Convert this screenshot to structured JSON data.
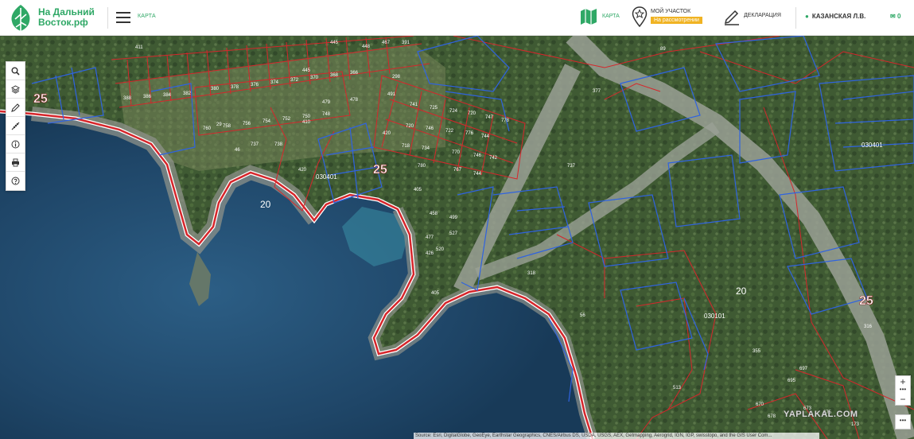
{
  "header": {
    "logo_line1": "На Дальний",
    "logo_line2": "Восток.рф",
    "menu_label": "КАРТА",
    "nav_map": "КАРТА",
    "nav_my_plot": "МОЙ УЧАСТОК",
    "nav_my_plot_status": "На рассмотрении",
    "nav_declaration": "ДЕКЛАРАЦИЯ",
    "user_name": "КАЗАНСКАЯ Л.В.",
    "messages_count": "0"
  },
  "colors": {
    "brand": "#2fa866",
    "status_badge": "#f0b323",
    "parcel_red": "#d6262b",
    "parcel_blue": "#2f63e0"
  },
  "toolbar": {
    "icons": [
      "search-icon",
      "layers-icon",
      "pencil-icon",
      "ruler-icon",
      "info-icon",
      "print-icon",
      "help-icon"
    ]
  },
  "map": {
    "labels": {
      "zone_left": "25",
      "zone_center": "25",
      "zone_right": "25",
      "lot_20_a": "20",
      "lot_20_b": "20",
      "code_right": "030401",
      "code_center": "030101",
      "code_west": "030401",
      "lot_89": "89",
      "lot_318": "318",
      "lot_316": "316",
      "lot_355": "355",
      "lot_513": "513",
      "lot_737": "737",
      "lot_405": "405",
      "lot_56": "56",
      "lot_420": "420",
      "lot_411": "411",
      "lot_391": "391",
      "lot_377": "377",
      "lot_29": "29"
    },
    "zoom_in": "+",
    "zoom_out": "−",
    "more": "•••",
    "watermark": "YAPLAKAL.COM",
    "attribution": "Source: Esri, DigitalGlobe, GeoEye, Earthstar Geographics, CNES/Airbus DS, USDA, USGS, AEX, Getmapping, Aerogrid, IGN, IGP, swisstopo, and the GIS User Com..."
  }
}
